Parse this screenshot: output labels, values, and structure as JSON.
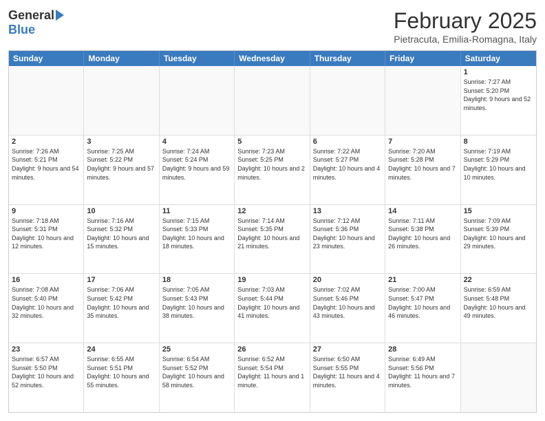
{
  "header": {
    "logo_general": "General",
    "logo_blue": "Blue",
    "month_title": "February 2025",
    "location": "Pietracuta, Emilia-Romagna, Italy"
  },
  "weekdays": [
    "Sunday",
    "Monday",
    "Tuesday",
    "Wednesday",
    "Thursday",
    "Friday",
    "Saturday"
  ],
  "rows": [
    [
      {
        "day": "",
        "info": ""
      },
      {
        "day": "",
        "info": ""
      },
      {
        "day": "",
        "info": ""
      },
      {
        "day": "",
        "info": ""
      },
      {
        "day": "",
        "info": ""
      },
      {
        "day": "",
        "info": ""
      },
      {
        "day": "1",
        "info": "Sunrise: 7:27 AM\nSunset: 5:20 PM\nDaylight: 9 hours and 52 minutes."
      }
    ],
    [
      {
        "day": "2",
        "info": "Sunrise: 7:26 AM\nSunset: 5:21 PM\nDaylight: 9 hours and 54 minutes."
      },
      {
        "day": "3",
        "info": "Sunrise: 7:25 AM\nSunset: 5:22 PM\nDaylight: 9 hours and 57 minutes."
      },
      {
        "day": "4",
        "info": "Sunrise: 7:24 AM\nSunset: 5:24 PM\nDaylight: 9 hours and 59 minutes."
      },
      {
        "day": "5",
        "info": "Sunrise: 7:23 AM\nSunset: 5:25 PM\nDaylight: 10 hours and 2 minutes."
      },
      {
        "day": "6",
        "info": "Sunrise: 7:22 AM\nSunset: 5:27 PM\nDaylight: 10 hours and 4 minutes."
      },
      {
        "day": "7",
        "info": "Sunrise: 7:20 AM\nSunset: 5:28 PM\nDaylight: 10 hours and 7 minutes."
      },
      {
        "day": "8",
        "info": "Sunrise: 7:19 AM\nSunset: 5:29 PM\nDaylight: 10 hours and 10 minutes."
      }
    ],
    [
      {
        "day": "9",
        "info": "Sunrise: 7:18 AM\nSunset: 5:31 PM\nDaylight: 10 hours and 12 minutes."
      },
      {
        "day": "10",
        "info": "Sunrise: 7:16 AM\nSunset: 5:32 PM\nDaylight: 10 hours and 15 minutes."
      },
      {
        "day": "11",
        "info": "Sunrise: 7:15 AM\nSunset: 5:33 PM\nDaylight: 10 hours and 18 minutes."
      },
      {
        "day": "12",
        "info": "Sunrise: 7:14 AM\nSunset: 5:35 PM\nDaylight: 10 hours and 21 minutes."
      },
      {
        "day": "13",
        "info": "Sunrise: 7:12 AM\nSunset: 5:36 PM\nDaylight: 10 hours and 23 minutes."
      },
      {
        "day": "14",
        "info": "Sunrise: 7:11 AM\nSunset: 5:38 PM\nDaylight: 10 hours and 26 minutes."
      },
      {
        "day": "15",
        "info": "Sunrise: 7:09 AM\nSunset: 5:39 PM\nDaylight: 10 hours and 29 minutes."
      }
    ],
    [
      {
        "day": "16",
        "info": "Sunrise: 7:08 AM\nSunset: 5:40 PM\nDaylight: 10 hours and 32 minutes."
      },
      {
        "day": "17",
        "info": "Sunrise: 7:06 AM\nSunset: 5:42 PM\nDaylight: 10 hours and 35 minutes."
      },
      {
        "day": "18",
        "info": "Sunrise: 7:05 AM\nSunset: 5:43 PM\nDaylight: 10 hours and 38 minutes."
      },
      {
        "day": "19",
        "info": "Sunrise: 7:03 AM\nSunset: 5:44 PM\nDaylight: 10 hours and 41 minutes."
      },
      {
        "day": "20",
        "info": "Sunrise: 7:02 AM\nSunset: 5:46 PM\nDaylight: 10 hours and 43 minutes."
      },
      {
        "day": "21",
        "info": "Sunrise: 7:00 AM\nSunset: 5:47 PM\nDaylight: 10 hours and 46 minutes."
      },
      {
        "day": "22",
        "info": "Sunrise: 6:59 AM\nSunset: 5:48 PM\nDaylight: 10 hours and 49 minutes."
      }
    ],
    [
      {
        "day": "23",
        "info": "Sunrise: 6:57 AM\nSunset: 5:50 PM\nDaylight: 10 hours and 52 minutes."
      },
      {
        "day": "24",
        "info": "Sunrise: 6:55 AM\nSunset: 5:51 PM\nDaylight: 10 hours and 55 minutes."
      },
      {
        "day": "25",
        "info": "Sunrise: 6:54 AM\nSunset: 5:52 PM\nDaylight: 10 hours and 58 minutes."
      },
      {
        "day": "26",
        "info": "Sunrise: 6:52 AM\nSunset: 5:54 PM\nDaylight: 11 hours and 1 minute."
      },
      {
        "day": "27",
        "info": "Sunrise: 6:50 AM\nSunset: 5:55 PM\nDaylight: 11 hours and 4 minutes."
      },
      {
        "day": "28",
        "info": "Sunrise: 6:49 AM\nSunset: 5:56 PM\nDaylight: 11 hours and 7 minutes."
      },
      {
        "day": "",
        "info": ""
      }
    ]
  ]
}
